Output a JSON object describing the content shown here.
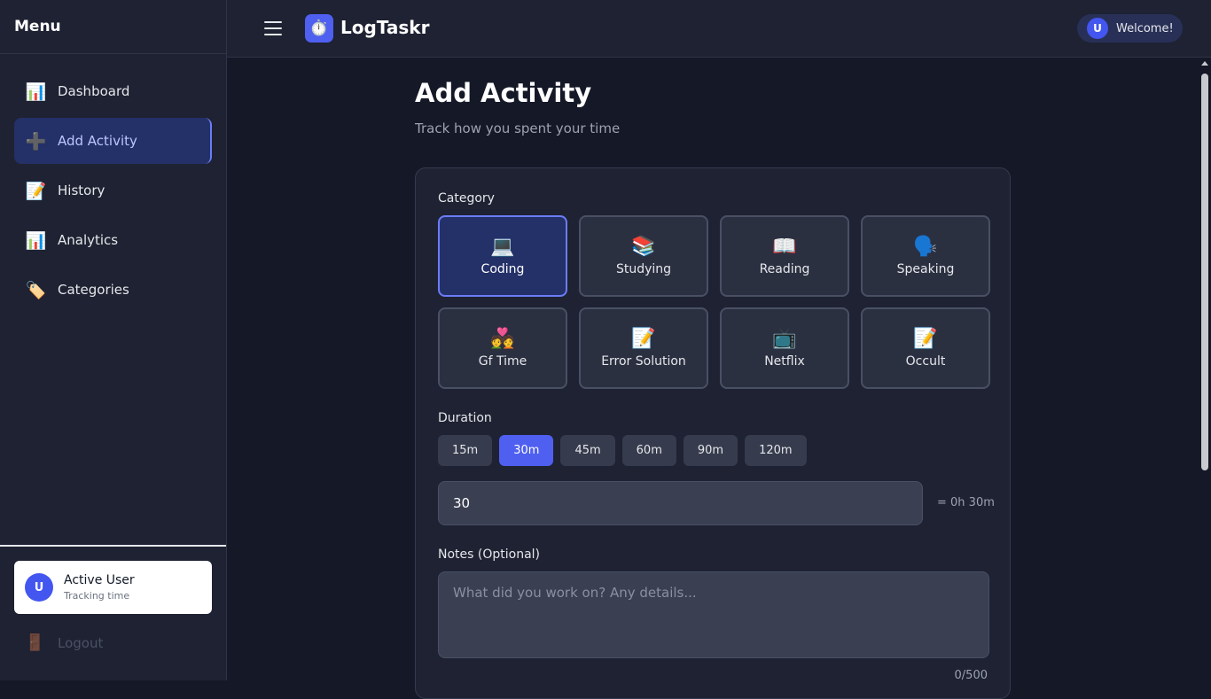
{
  "sidebar": {
    "title": "Menu",
    "items": [
      {
        "icon": "📊",
        "label": "Dashboard"
      },
      {
        "icon": "➕",
        "label": "Add Activity"
      },
      {
        "icon": "📝",
        "label": "History"
      },
      {
        "icon": "📊",
        "label": "Analytics"
      },
      {
        "icon": "🏷️",
        "label": "Categories"
      }
    ],
    "active_item": "Add Activity",
    "user": {
      "initial": "U",
      "name": "Active User",
      "status": "Tracking time"
    },
    "logout": {
      "icon": "🚪",
      "label": "Logout"
    }
  },
  "topbar": {
    "app_icon": "⏱️",
    "app_name": "LogTaskr",
    "welcome": {
      "initial": "U",
      "text": "Welcome!"
    }
  },
  "main": {
    "title": "Add Activity",
    "subtitle": "Track how you spent your time",
    "category": {
      "label": "Category",
      "selected": "Coding",
      "options": [
        {
          "icon": "💻",
          "label": "Coding"
        },
        {
          "icon": "📚",
          "label": "Studying"
        },
        {
          "icon": "📖",
          "label": "Reading"
        },
        {
          "icon": "🗣️",
          "label": "Speaking"
        },
        {
          "icon": "💑",
          "label": "Gf Time"
        },
        {
          "icon": "📝",
          "label": "Error Solution"
        },
        {
          "icon": "📺",
          "label": "Netflix"
        },
        {
          "icon": "📝",
          "label": "Occult"
        }
      ]
    },
    "duration": {
      "label": "Duration",
      "presets": [
        "15m",
        "30m",
        "45m",
        "60m",
        "90m",
        "120m"
      ],
      "selected": "30m",
      "input_value": "30",
      "readout": "= 0h 30m"
    },
    "notes": {
      "label": "Notes (Optional)",
      "placeholder": "What did you work on? Any details...",
      "value": "",
      "counter": "0/500"
    }
  },
  "colors": {
    "accent": "#4f5ff0",
    "sidebar_bg": "#1e2232",
    "main_bg": "#151827",
    "active_nav_bg": "#243068"
  }
}
